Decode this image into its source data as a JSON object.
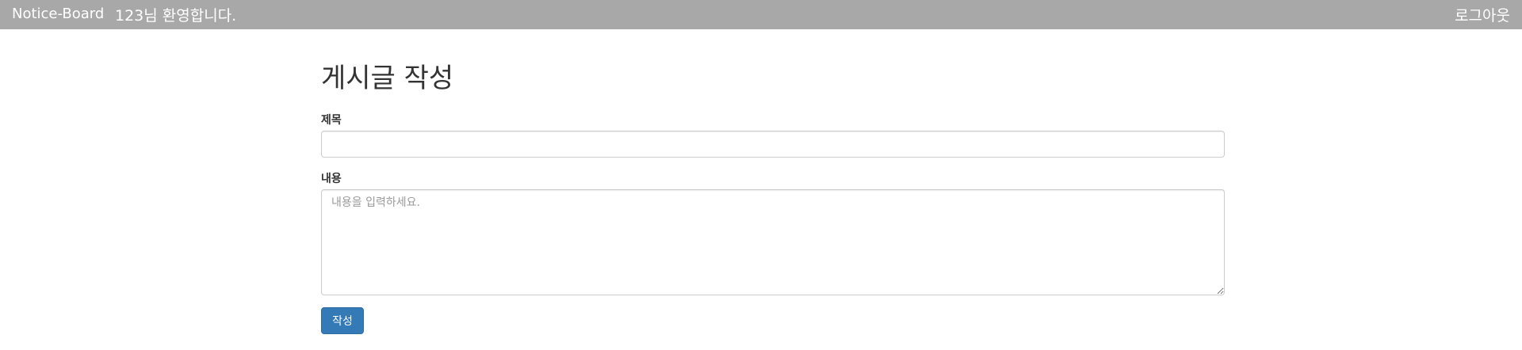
{
  "navbar": {
    "brand": "Notice-Board",
    "welcome": "123님 환영합니다.",
    "logout": "로그아웃",
    "background_color": "#a8a8a8"
  },
  "form": {
    "page_title": "게시글 작성",
    "title_label": "제목",
    "title_value": "",
    "content_label": "내용",
    "content_value": "",
    "content_placeholder": "내용을 입력하세요.",
    "submit_label": "작성",
    "submit_color": "#337ab7"
  }
}
